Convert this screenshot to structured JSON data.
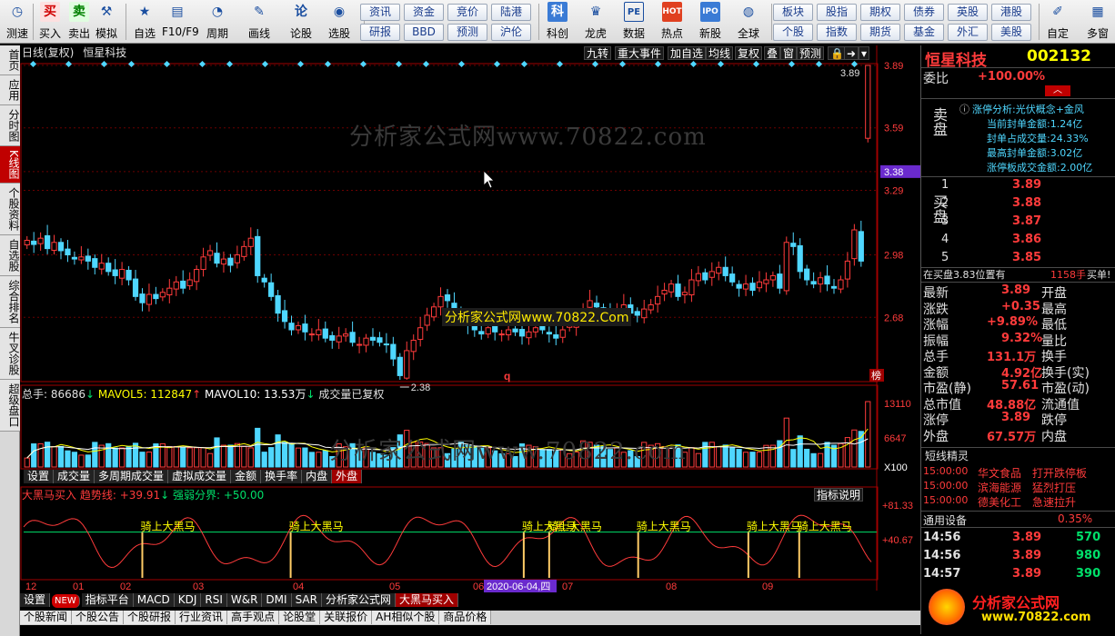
{
  "toolbar": {
    "buttons": [
      {
        "label": "测速",
        "icon": "speed-icon"
      },
      {
        "label": "买入",
        "icon": "buy-icon"
      },
      {
        "label": "卖出",
        "icon": "sell-icon"
      },
      {
        "label": "模拟",
        "icon": "hammer-icon"
      },
      {
        "label": "自选",
        "icon": "star-icon"
      },
      {
        "label": "F10/F9",
        "icon": "f10-icon"
      },
      {
        "label": "周期",
        "icon": "clock-icon"
      },
      {
        "label": "画线",
        "icon": "pen-icon"
      },
      {
        "label": "论股",
        "icon": "forum-icon"
      },
      {
        "label": "选股",
        "icon": "stock-pick-icon"
      },
      {
        "label": "科创",
        "icon": "kechuang-icon"
      },
      {
        "label": "龙虎",
        "icon": "dragon-icon"
      },
      {
        "label": "数据",
        "icon": "data-icon"
      },
      {
        "label": "热点",
        "icon": "hot-icon"
      },
      {
        "label": "新股",
        "icon": "ipo-icon"
      },
      {
        "label": "全球",
        "icon": "globe-icon"
      },
      {
        "label": "自定",
        "icon": "custom-icon"
      },
      {
        "label": "多窗",
        "icon": "window-icon"
      }
    ],
    "grid_buttons": [
      [
        "资讯",
        "资金",
        "竞价",
        "陆港"
      ],
      [
        "研报",
        "BBD",
        "预测",
        "沪伦"
      ],
      [
        "板块",
        "股指",
        "期权",
        "债券",
        "英股",
        "港股"
      ],
      [
        "个股",
        "指数",
        "期货",
        "基金",
        "外汇",
        "美股"
      ]
    ],
    "icon_glyphs": {
      "buy": "买",
      "sell": "卖",
      "forum": "论",
      "kechuang": "科",
      "pe": "PE",
      "hot": "HOT",
      "ipo": "IPO"
    }
  },
  "left_tabs": [
    "首页",
    "应用",
    "分时图",
    "K线图",
    "个股资料",
    "自选股",
    "综合排名",
    "牛叉诊股",
    "超级盘口"
  ],
  "chart_header": {
    "title": "日线(复权)",
    "stock_name": "恒星科技",
    "tools": [
      "九转",
      "重大事件",
      "加自选",
      "均线",
      "复权",
      "叠",
      "窗",
      "预测"
    ]
  },
  "price_axis": [
    "3.89",
    "3.59",
    "3.38",
    "3.29",
    "2.98",
    "2.68"
  ],
  "price_labels": {
    "high": "3.89",
    "low": "2.38",
    "q_marker": "q",
    "bang": "榜"
  },
  "volume": {
    "header": [
      {
        "text": "总手: 86686",
        "color": "#e0e0e0"
      },
      {
        "text": "↓",
        "color": "#00e06a"
      },
      {
        "text": " MAVOL5: 112847",
        "color": "#ffff00"
      },
      {
        "text": "↑",
        "color": "#ff3b3b"
      },
      {
        "text": " MAVOL10: 13.53万",
        "color": "#ffffff"
      },
      {
        "text": "↓",
        "color": "#00e06a"
      },
      {
        "text": "  成交量已复权",
        "color": "#e0e0e0"
      }
    ],
    "axis": [
      "13110",
      "6647",
      "X100"
    ],
    "tabs": [
      "设置",
      "成交量",
      "多周期成交量",
      "虚拟成交量",
      "金额",
      "换手率",
      "内盘",
      "外盘"
    ],
    "selected_tab": "外盘"
  },
  "indicator": {
    "header": [
      {
        "text": "大黑马买入",
        "color": "#ff3b3b"
      },
      {
        "text": " 趋势线: +39.91",
        "color": "#ff3b3b"
      },
      {
        "text": "↓",
        "color": "#00e06a"
      },
      {
        "text": " 强弱分界: +50.00",
        "color": "#00e06a"
      }
    ],
    "help_button": "指标说明",
    "axis": [
      "+81.33",
      "+40.67"
    ],
    "signal_label": "骑上大黑马",
    "tabs": [
      "设置",
      "NEW",
      "指标平台",
      "MACD",
      "KDJ",
      "RSI",
      "W&R",
      "DMI",
      "SAR",
      "分析家公式网",
      "大黑马买入"
    ],
    "selected_tab": "大黑马买入"
  },
  "time_axis": [
    "12",
    "01",
    "02",
    "03",
    "04",
    "05",
    "06",
    "07",
    "08",
    "09"
  ],
  "time_cursor": "2020-06-04,四",
  "bottom_tabs": [
    "个股新闻",
    "个股公告",
    "个股研报",
    "行业资讯",
    "高手观点",
    "论股堂",
    "关联报价",
    "AH相似个股",
    "商品价格"
  ],
  "watermark": {
    "text": "分析家公式网www.70822.com",
    "caption": "分析家公式网www.70822.Com"
  },
  "chart_data": {
    "type": "candlestick",
    "title": "日线(复权)",
    "series_name": "恒星科技",
    "ylim": [
      2.38,
      3.89
    ],
    "y_ticks": [
      3.89,
      3.59,
      3.38,
      3.29,
      2.98,
      2.68
    ],
    "x_ticks": [
      "12",
      "01",
      "02",
      "03",
      "04",
      "05",
      "06",
      "07",
      "08",
      "09"
    ],
    "close": [
      3.05,
      3.03,
      3.06,
      3.01,
      3.04,
      3.0,
      2.98,
      2.96,
      2.97,
      2.95,
      2.92,
      2.94,
      2.9,
      2.88,
      2.91,
      2.86,
      2.78,
      2.75,
      2.79,
      2.77,
      2.8,
      2.82,
      2.85,
      2.82,
      2.86,
      2.91,
      2.97,
      3.0,
      2.94,
      2.96,
      2.93,
      2.98,
      3.02,
      3.06,
      2.88,
      2.85,
      2.78,
      2.7,
      2.66,
      2.62,
      2.64,
      2.61,
      2.6,
      2.62,
      2.58,
      2.57,
      2.59,
      2.6,
      2.56,
      2.55,
      2.58,
      2.57,
      2.56,
      2.55,
      2.48,
      2.4,
      2.52,
      2.57,
      2.63,
      2.69,
      2.73,
      2.78,
      2.76,
      2.7,
      2.66,
      2.64,
      2.62,
      2.6,
      2.63,
      2.61,
      2.6,
      2.62,
      2.61,
      2.59,
      2.61,
      2.63,
      2.62,
      2.6,
      2.58,
      2.62,
      2.64,
      2.68,
      2.72,
      2.76,
      2.73,
      2.7,
      2.68,
      2.72,
      2.74,
      2.7,
      2.69,
      2.72,
      2.74,
      2.78,
      2.81,
      2.84,
      2.78,
      2.8,
      2.86,
      2.89,
      2.86,
      2.9,
      2.92,
      2.88,
      2.85,
      2.82,
      2.84,
      2.81,
      2.85,
      2.86,
      2.88,
      2.82,
      3.04,
      3.02,
      2.9,
      2.86,
      2.84,
      2.87,
      2.84,
      2.82,
      2.86,
      2.95,
      3.1,
      2.95,
      3.89
    ],
    "volume_ylim": [
      0,
      13110
    ],
    "indicator_ylim": [
      0,
      81.33
    ],
    "trend_line": 39.91,
    "threshold": 50.0,
    "signal_positions": [
      0.14,
      0.315,
      0.59,
      0.62,
      0.725,
      0.855,
      0.915
    ]
  },
  "right_panel": {
    "stock_name": "恒星科技",
    "stock_code": "002132",
    "commission_label": "委比",
    "commission_value": "+100.00%",
    "sell_label": "卖盘",
    "limit_info": [
      {
        "text": "涨停分析:光伏概念+金风",
        "color": "#4fd7ff"
      },
      {
        "text": "当前封单金额:1.24亿",
        "color": "#4fd7ff"
      },
      {
        "text": "封单占成交量:24.33%",
        "color": "#4fd7ff"
      },
      {
        "text": "最高封单金额:3.02亿",
        "color": "#4fd7ff"
      },
      {
        "text": "涨停板成交金额:2.00亿",
        "color": "#4fd7ff"
      }
    ],
    "buy_label": "买盘",
    "buy_levels": [
      {
        "level": "1",
        "price": "3.89"
      },
      {
        "level": "2",
        "price": "3.88"
      },
      {
        "level": "3",
        "price": "3.87"
      },
      {
        "level": "4",
        "price": "3.86"
      },
      {
        "level": "5",
        "price": "3.85"
      }
    ],
    "buy_note": {
      "prefix": "在买盘3.83位置有",
      "qty": "1158手",
      "suffix": "买单!"
    },
    "quote_rows": [
      {
        "l": "最新",
        "lv": "3.89",
        "r": "开盘"
      },
      {
        "l": "涨跌",
        "lv": "+0.35",
        "r": "最高"
      },
      {
        "l": "涨幅",
        "lv": "+9.89%",
        "r": "最低"
      },
      {
        "l": "振幅",
        "lv": "9.32%",
        "r": "量比"
      },
      {
        "l": "总手",
        "lv": "131.1万",
        "r": "换手"
      },
      {
        "l": "金额",
        "lv": "4.92亿",
        "r": "换手(实)"
      },
      {
        "l": "市盈(静)",
        "lv": "57.61",
        "r": "市盈(动)"
      },
      {
        "l": "总市值",
        "lv": "48.88亿",
        "r": "流通值"
      },
      {
        "l": "涨停",
        "lv": "3.89",
        "r": "跌停"
      },
      {
        "l": "外盘",
        "lv": "67.57万",
        "r": "内盘"
      }
    ],
    "elves_title": "短线精灵",
    "elves": [
      {
        "time": "15:00:00",
        "name": "华文食品",
        "event": "打开跌停板"
      },
      {
        "time": "15:00:00",
        "name": "滨海能源",
        "event": "猛烈打压"
      },
      {
        "time": "15:00:00",
        "name": "德美化工",
        "event": "急速拉升"
      }
    ],
    "general_label": "通用设备",
    "general_value": "0.35%",
    "trades": [
      {
        "time": "14:56",
        "price": "3.89",
        "vol": "570"
      },
      {
        "time": "14:56",
        "price": "3.89",
        "vol": "980"
      },
      {
        "time": "14:57",
        "price": "3.89",
        "vol": "390"
      }
    ],
    "logo_text": "分析家公式网",
    "logo_url": "www.70822.com"
  },
  "colors": {
    "up": "#ff3b3b",
    "down": "#4fd7ff",
    "bg": "#000000",
    "grid": "#8b0000"
  }
}
